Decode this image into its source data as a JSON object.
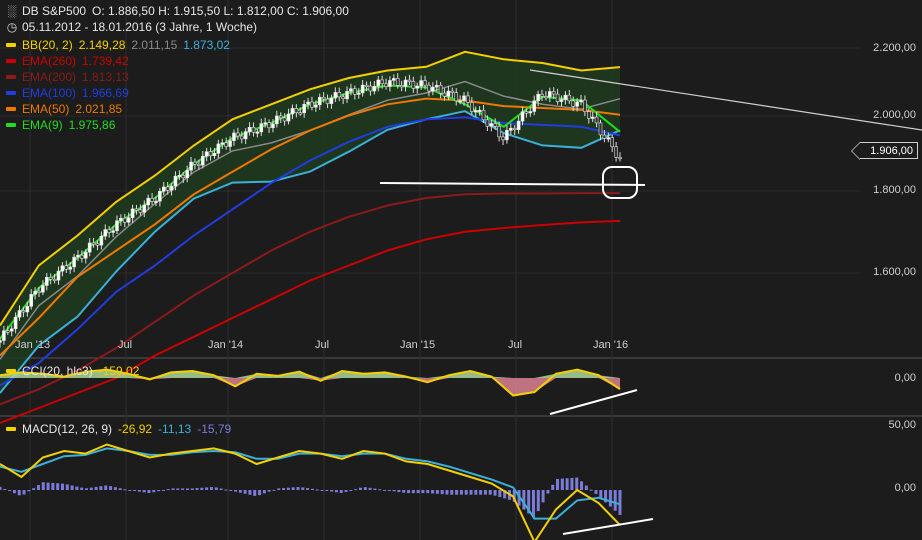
{
  "header": {
    "symbol": "DB S&P500",
    "ohlc": "O: 1.886,50   H: 1.915,50   L: 1.812,00   C: 1.906,00",
    "range": "05.11.2012 - 18.01.2016 (3 Jahre, 1 Woche)",
    "symbol_icon": "bar-chart-icon",
    "range_icon": "clock-icon"
  },
  "indicators": [
    {
      "name": "BB(20, 2)",
      "color": "#f5d000",
      "values": [
        {
          "text": "2.149,28",
          "color": "#f5d000"
        },
        {
          "text": "2.011,15",
          "color": "#8a8a8a"
        },
        {
          "text": "1.873,02",
          "color": "#3bb0d8"
        }
      ]
    },
    {
      "name": "EMA(260)",
      "color": "#cc0000",
      "values": [
        {
          "text": "1.739,42",
          "color": "#cc0000"
        }
      ]
    },
    {
      "name": "EMA(200)",
      "color": "#8b1a1a",
      "values": [
        {
          "text": "1.813,13",
          "color": "#8b1a1a"
        }
      ]
    },
    {
      "name": "EMA(100)",
      "color": "#1f3de0",
      "values": [
        {
          "text": "1.966,69",
          "color": "#1f3de0"
        }
      ]
    },
    {
      "name": "EMA(50)",
      "color": "#f07800",
      "values": [
        {
          "text": "2.021,85",
          "color": "#f07800"
        }
      ]
    },
    {
      "name": "EMA(9)",
      "color": "#22dd22",
      "values": [
        {
          "text": "1.975,86",
          "color": "#22dd22"
        }
      ]
    }
  ],
  "price_tag": "1.906,00",
  "cci": {
    "label": "CCI(20, hlc3)",
    "value": "-159,02",
    "axis": [
      "0,00"
    ]
  },
  "macd": {
    "label": "MACD(12, 26, 9)",
    "value": "-26,92",
    "signal": "-11,13",
    "hist": "-15,79",
    "axis": [
      "50,00",
      "0,00"
    ]
  },
  "chart_data": [
    {
      "type": "line",
      "title": "DB S&P500",
      "x": [
        "Jan '13",
        "Jul",
        "Jan '14",
        "Jul",
        "Jan '15",
        "Jul",
        "Jan '16"
      ],
      "yticks": [
        "1.600,00",
        "1.800,00",
        "2.000,00",
        "2.200,00"
      ],
      "ylim": [
        1380,
        2250
      ],
      "series": [
        {
          "name": "S&P500",
          "color": "#ffffff",
          "values": [
            1420,
            1560,
            1640,
            1730,
            1800,
            1890,
            1960,
            2000,
            2050,
            2080,
            2110,
            2100,
            2060,
            1960,
            2080,
            2050,
            1906
          ]
        },
        {
          "name": "BB(20, 2)",
          "color": "#f5d000",
          "values": [
            1460,
            1620,
            1700,
            1790,
            1860,
            1940,
            2010,
            2050,
            2090,
            2120,
            2140,
            2150,
            2190,
            2170,
            2160,
            2140,
            2149
          ]
        },
        {
          "name": "EMA(9)",
          "color": "#22dd22",
          "values": [
            1425,
            1560,
            1640,
            1730,
            1800,
            1890,
            1960,
            2000,
            2050,
            2080,
            2100,
            2095,
            2050,
            1990,
            2070,
            2060,
            1976
          ]
        },
        {
          "name": "EMA(50)",
          "color": "#f07800",
          "values": [
            1380,
            1480,
            1590,
            1660,
            1730,
            1810,
            1870,
            1930,
            1980,
            2020,
            2050,
            2065,
            2060,
            2045,
            2040,
            2035,
            2022
          ]
        },
        {
          "name": "EMA(100)",
          "color": "#1f3de0",
          "values": [
            1300,
            1360,
            1450,
            1550,
            1620,
            1700,
            1770,
            1840,
            1900,
            1950,
            1990,
            2010,
            2015,
            2000,
            1995,
            1990,
            1967
          ]
        },
        {
          "name": "EMA(200)",
          "color": "#8b1a1a",
          "values": [
            1250,
            1290,
            1340,
            1400,
            1470,
            1540,
            1600,
            1660,
            1710,
            1750,
            1780,
            1800,
            1810,
            1812,
            1812,
            1813,
            1813
          ]
        },
        {
          "name": "EMA(260)",
          "color": "#cc0000",
          "values": [
            1200,
            1240,
            1280,
            1320,
            1380,
            1430,
            1480,
            1530,
            1580,
            1620,
            1660,
            1690,
            1710,
            1720,
            1728,
            1735,
            1739
          ]
        }
      ]
    },
    {
      "type": "line",
      "title": "CCI(20, hlc3)",
      "yticks": [
        "0,00"
      ],
      "series": [
        {
          "name": "CCI(20, hlc3)",
          "color": "#f5d000",
          "values": [
            40,
            80,
            60,
            20,
            90,
            120,
            60,
            -20,
            80,
            100,
            40,
            -120,
            60,
            30,
            90,
            -40,
            100,
            60,
            80,
            20,
            -60,
            40,
            100,
            20,
            -250,
            -200,
            60,
            120,
            40,
            -159
          ]
        }
      ]
    },
    {
      "type": "line",
      "title": "MACD(12, 26, 9)",
      "yticks": [
        "50,00",
        "0,00"
      ],
      "series": [
        {
          "name": "MACD",
          "color": "#f5d000",
          "values": [
            20,
            10,
            25,
            30,
            28,
            35,
            30,
            25,
            28,
            30,
            32,
            28,
            20,
            25,
            30,
            28,
            24,
            30,
            28,
            22,
            20,
            15,
            10,
            5,
            -5,
            -40,
            -15,
            0,
            -10,
            -27
          ]
        },
        {
          "name": "Signal",
          "color": "#3bb0d8",
          "values": [
            18,
            14,
            20,
            26,
            27,
            32,
            30,
            27,
            27,
            29,
            30,
            29,
            24,
            24,
            28,
            28,
            26,
            28,
            28,
            24,
            22,
            18,
            13,
            8,
            2,
            -22,
            -22,
            -8,
            -6,
            -11
          ]
        }
      ]
    }
  ]
}
